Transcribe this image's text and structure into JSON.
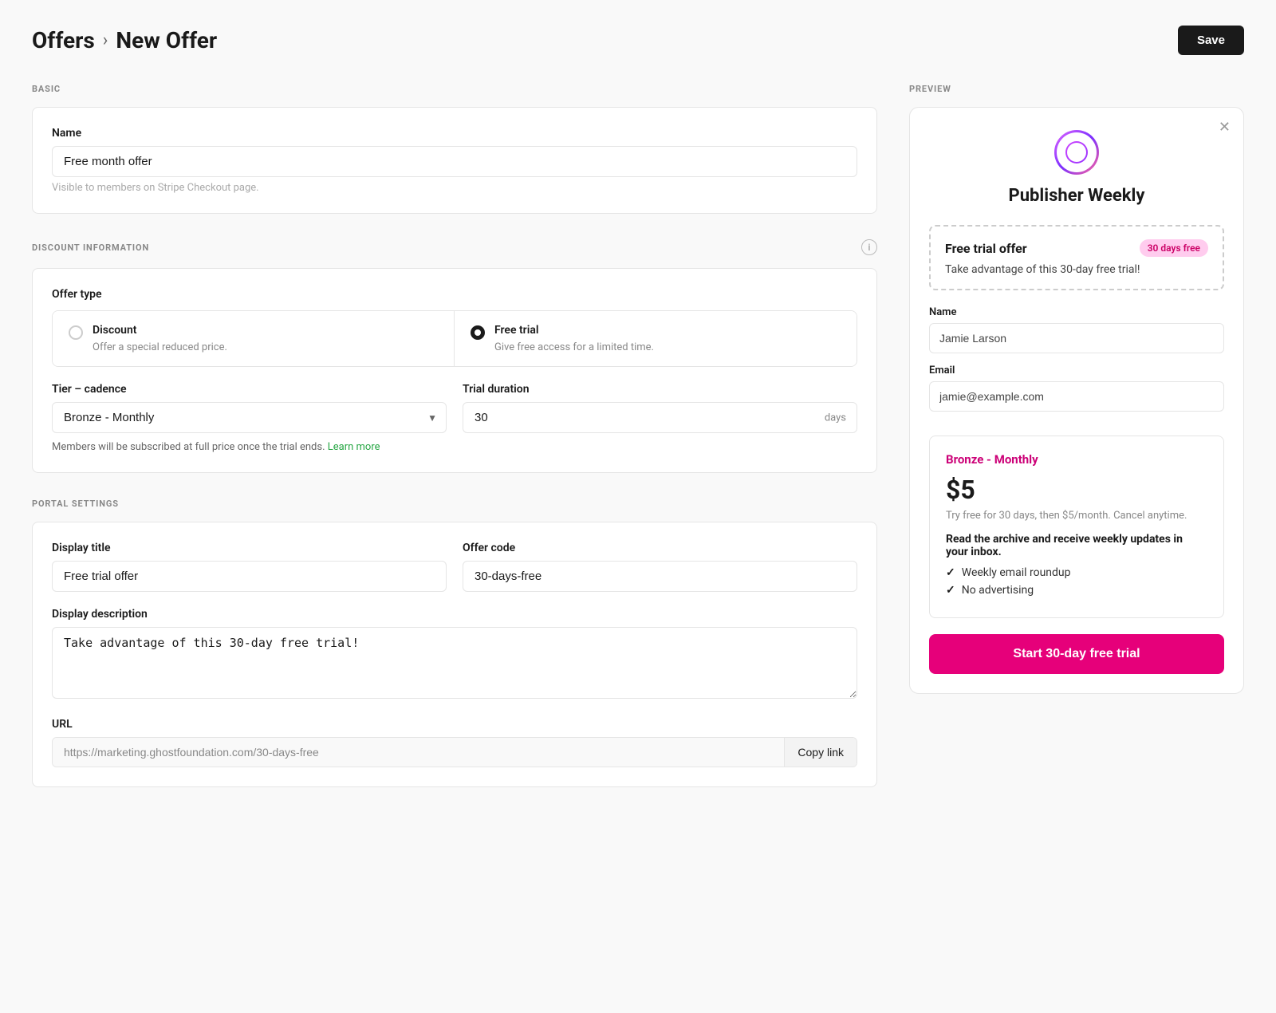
{
  "header": {
    "parent_label": "Offers",
    "separator": "›",
    "current_label": "New Offer",
    "save_button": "Save"
  },
  "left": {
    "basic_section_label": "BASIC",
    "name_field_label": "Name",
    "name_field_value": "Free month offer",
    "name_field_hint": "Visible to members on Stripe Checkout page.",
    "discount_section_label": "DISCOUNT INFORMATION",
    "offer_type_label": "Offer type",
    "discount_option_title": "Discount",
    "discount_option_desc": "Offer a special reduced price.",
    "free_trial_option_title": "Free trial",
    "free_trial_option_desc": "Give free access for a limited time.",
    "tier_cadence_label": "Tier – cadence",
    "tier_cadence_value": "Bronze - Monthly",
    "trial_duration_label": "Trial duration",
    "trial_duration_value": "30",
    "trial_duration_suffix": "days",
    "trial_hint": "Members will be subscribed at full price once the trial ends.",
    "trial_hint_link": "Learn more",
    "portal_section_label": "PORTAL SETTINGS",
    "display_title_label": "Display title",
    "display_title_value": "Free trial offer",
    "offer_code_label": "Offer code",
    "offer_code_value": "30-days-free",
    "display_description_label": "Display description",
    "display_description_value": "Take advantage of this 30-day free trial!",
    "url_label": "URL",
    "url_value": "https://marketing.ghostfoundation.com/30-days-free",
    "copy_link_label": "Copy link"
  },
  "preview": {
    "section_label": "PREVIEW",
    "pub_name": "Publisher Weekly",
    "offer_title": "Free trial offer",
    "offer_badge": "30 days free",
    "offer_description": "Take advantage of this 30-day free trial!",
    "name_label": "Name",
    "name_placeholder": "Jamie Larson",
    "email_label": "Email",
    "email_placeholder": "jamie@example.com",
    "tier_name": "Bronze - Monthly",
    "price": "$5",
    "price_hint": "Try free for 30 days, then $5/month. Cancel anytime.",
    "benefits_title": "Read the archive and receive weekly updates in your inbox.",
    "benefit_1": "Weekly email roundup",
    "benefit_2": "No advertising",
    "cta_button": "Start 30-day free trial"
  }
}
